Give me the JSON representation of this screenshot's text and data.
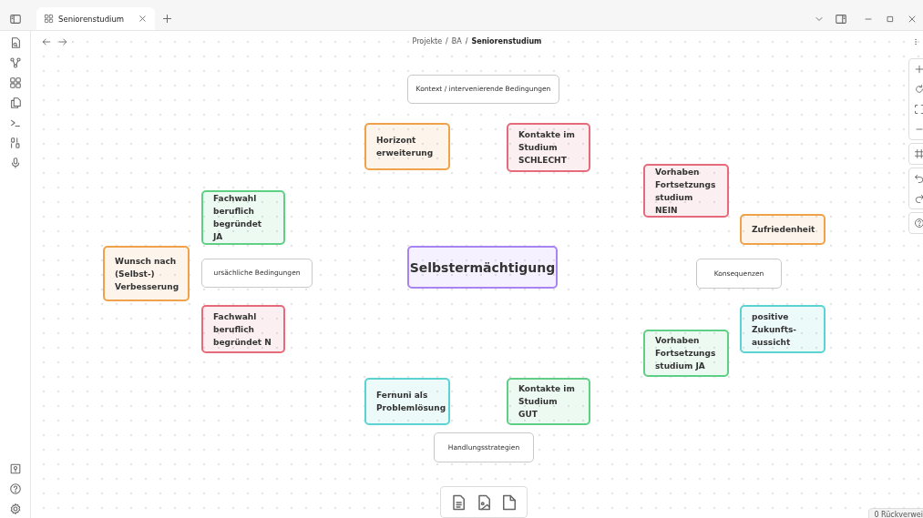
{
  "tab_bar": {
    "tabs": [
      {
        "title": "Seniorenstudium",
        "selected": true
      }
    ]
  },
  "breadcrumb": {
    "path": [
      "Projekte",
      "BA"
    ],
    "separator": "/",
    "current": "Seniorenstudium"
  },
  "canvas": {
    "nodes": [
      {
        "kind": "label",
        "text": "Kontext / intervenierende Bedingungen"
      },
      {
        "kind": "note",
        "text": "Horizont\nerweiterung",
        "color": "#f0a24a"
      },
      {
        "kind": "note",
        "text": "Kontakte im\nStudium\nSCHLECHT",
        "color": "#e66a7c"
      },
      {
        "kind": "note",
        "text": "Vorhaben\nFortsetzungs\nstudium NEIN",
        "color": "#e66a7c"
      },
      {
        "kind": "note",
        "text": "Fachwahl\nberuflich\nbegründet JA",
        "color": "#5fcf86"
      },
      {
        "kind": "note",
        "text": "Zufriedenheit",
        "color": "#f0a24a"
      },
      {
        "kind": "note",
        "text": "Wunsch nach\n(Selbst-)\nVerbesserung",
        "color": "#f0a24a"
      },
      {
        "kind": "label",
        "text": "ursächliche Bedingungen"
      },
      {
        "kind": "core",
        "text": "Selbstermächtigung",
        "color": "#a884f3"
      },
      {
        "kind": "label",
        "text": "Konsequenzen"
      },
      {
        "kind": "note",
        "text": "Fachwahl\nberuflich\nbegründet N",
        "color": "#e66a7c"
      },
      {
        "kind": "note",
        "text": "positive\nZukunfts-\naussicht",
        "color": "#5bd3d3"
      },
      {
        "kind": "note",
        "text": "Vorhaben\nFortsetzungs\nstudium JA",
        "color": "#5fcf86"
      },
      {
        "kind": "note",
        "text": "Fernuni als\nProblemlösung",
        "color": "#5bd3d3"
      },
      {
        "kind": "note",
        "text": "Kontakte im\nStudium GUT",
        "color": "#5fcf86"
      },
      {
        "kind": "label",
        "text": "Handlungsstrategien"
      }
    ]
  },
  "status_bar": {
    "text": "0 Rückverwei"
  }
}
